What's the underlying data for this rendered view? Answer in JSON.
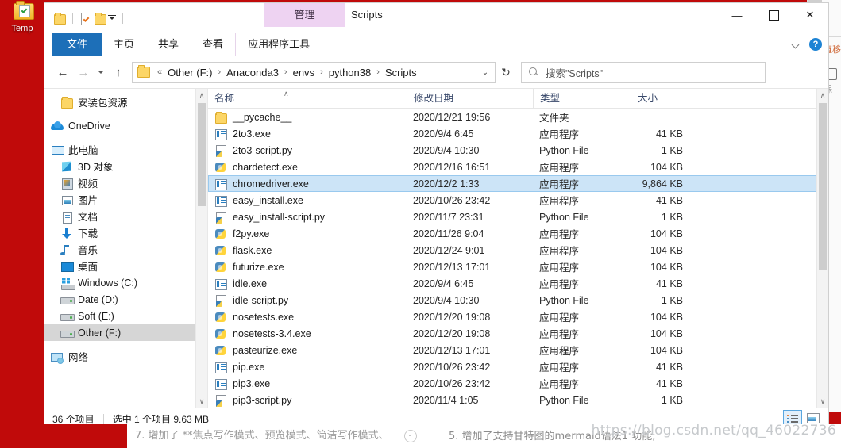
{
  "desktop": {
    "icon_label": "Temp",
    "icon_name": "folder-check-icon",
    "background_color": "#c00a0a"
  },
  "window": {
    "title": "Scripts",
    "contextual_tab_group": "管理",
    "controls": {
      "minimize": "—",
      "maximize": "☐",
      "close": "✕"
    },
    "help_label": "?"
  },
  "quick_access_toolbar": {
    "items": [
      {
        "name": "new-folder-icon",
        "tooltip": "新建文件夹"
      },
      {
        "name": "properties-icon",
        "tooltip": "属性"
      },
      {
        "name": "folder-icon",
        "tooltip": "文件夹"
      },
      {
        "name": "customize-caret-icon",
        "tooltip": "自定义快速访问工具栏"
      }
    ]
  },
  "ribbon": {
    "tabs": [
      {
        "label": "文件",
        "active_style": "file"
      },
      {
        "label": "主页",
        "active_style": "normal"
      },
      {
        "label": "共享",
        "active_style": "normal"
      },
      {
        "label": "查看",
        "active_style": "normal"
      },
      {
        "label": "应用程序工具",
        "active_style": "contextual"
      }
    ],
    "collapse_icon": "chevron-down-icon",
    "help_icon": "help-icon"
  },
  "address_bar": {
    "back": "←",
    "forward": "→",
    "recent_caret": "⌄",
    "up": "↑",
    "overflow": "«",
    "breadcrumbs": [
      "Other (F:)",
      "Anaconda3",
      "envs",
      "python38",
      "Scripts"
    ],
    "separator": "›",
    "dropdown_caret": "⌄",
    "refresh": "↻"
  },
  "search": {
    "placeholder": "搜索\"Scripts\"",
    "icon": "search-icon"
  },
  "sidebar": {
    "items": [
      {
        "label": "安装包资源",
        "icon": "folder-icon",
        "indent": 1,
        "selected": false
      },
      {
        "label": "OneDrive",
        "icon": "cloud-icon",
        "indent": 0,
        "selected": false,
        "gap_before": true
      },
      {
        "label": "此电脑",
        "icon": "pc-icon",
        "indent": 0,
        "selected": false,
        "gap_before": true
      },
      {
        "label": "3D 对象",
        "icon": "3d-objects-icon",
        "indent": 1,
        "selected": false
      },
      {
        "label": "视频",
        "icon": "video-icon",
        "indent": 1,
        "selected": false
      },
      {
        "label": "图片",
        "icon": "pictures-icon",
        "indent": 1,
        "selected": false
      },
      {
        "label": "文档",
        "icon": "documents-icon",
        "indent": 1,
        "selected": false
      },
      {
        "label": "下载",
        "icon": "downloads-icon",
        "indent": 1,
        "selected": false
      },
      {
        "label": "音乐",
        "icon": "music-icon",
        "indent": 1,
        "selected": false
      },
      {
        "label": "桌面",
        "icon": "desktop-icon",
        "indent": 1,
        "selected": false
      },
      {
        "label": "Windows (C:)",
        "icon": "windows-drive-icon",
        "indent": 1,
        "selected": false
      },
      {
        "label": "Date (D:)",
        "icon": "drive-icon",
        "indent": 1,
        "selected": false
      },
      {
        "label": "Soft (E:)",
        "icon": "drive-icon",
        "indent": 1,
        "selected": false
      },
      {
        "label": "Other (F:)",
        "icon": "drive-icon",
        "indent": 1,
        "selected": true
      },
      {
        "label": "网络",
        "icon": "network-icon",
        "indent": 0,
        "selected": false,
        "gap_before": true
      }
    ],
    "scrollbar": {
      "up_arrow": "∧",
      "down_arrow": "∨"
    }
  },
  "file_list": {
    "columns": [
      {
        "label": "名称",
        "key": "name"
      },
      {
        "label": "修改日期",
        "key": "date"
      },
      {
        "label": "类型",
        "key": "type"
      },
      {
        "label": "大小",
        "key": "size"
      }
    ],
    "sort_indicator": "∧",
    "sort_column": "名称",
    "rows": [
      {
        "name": "__pycache__",
        "date": "2020/12/21 19:56",
        "type": "文件夹",
        "size": "",
        "icon": "folder-icon",
        "selected": false
      },
      {
        "name": "2to3.exe",
        "date": "2020/9/4 6:45",
        "type": "应用程序",
        "size": "41 KB",
        "icon": "exe-icon",
        "selected": false
      },
      {
        "name": "2to3-script.py",
        "date": "2020/9/4 10:30",
        "type": "Python File",
        "size": "1 KB",
        "icon": "python-file-icon",
        "selected": false
      },
      {
        "name": "chardetect.exe",
        "date": "2020/12/16 16:51",
        "type": "应用程序",
        "size": "104 KB",
        "icon": "python-exe-icon",
        "selected": false
      },
      {
        "name": "chromedriver.exe",
        "date": "2020/12/2 1:33",
        "type": "应用程序",
        "size": "9,864 KB",
        "icon": "exe-icon",
        "selected": true
      },
      {
        "name": "easy_install.exe",
        "date": "2020/10/26 23:42",
        "type": "应用程序",
        "size": "41 KB",
        "icon": "exe-icon",
        "selected": false
      },
      {
        "name": "easy_install-script.py",
        "date": "2020/11/7 23:31",
        "type": "Python File",
        "size": "1 KB",
        "icon": "python-file-icon",
        "selected": false
      },
      {
        "name": "f2py.exe",
        "date": "2020/11/26 9:04",
        "type": "应用程序",
        "size": "104 KB",
        "icon": "python-exe-icon",
        "selected": false
      },
      {
        "name": "flask.exe",
        "date": "2020/12/24 9:01",
        "type": "应用程序",
        "size": "104 KB",
        "icon": "python-exe-icon",
        "selected": false
      },
      {
        "name": "futurize.exe",
        "date": "2020/12/13 17:01",
        "type": "应用程序",
        "size": "104 KB",
        "icon": "python-exe-icon",
        "selected": false
      },
      {
        "name": "idle.exe",
        "date": "2020/9/4 6:45",
        "type": "应用程序",
        "size": "41 KB",
        "icon": "exe-icon",
        "selected": false
      },
      {
        "name": "idle-script.py",
        "date": "2020/9/4 10:30",
        "type": "Python File",
        "size": "1 KB",
        "icon": "python-file-icon",
        "selected": false
      },
      {
        "name": "nosetests.exe",
        "date": "2020/12/20 19:08",
        "type": "应用程序",
        "size": "104 KB",
        "icon": "python-exe-icon",
        "selected": false
      },
      {
        "name": "nosetests-3.4.exe",
        "date": "2020/12/20 19:08",
        "type": "应用程序",
        "size": "104 KB",
        "icon": "python-exe-icon",
        "selected": false
      },
      {
        "name": "pasteurize.exe",
        "date": "2020/12/13 17:01",
        "type": "应用程序",
        "size": "104 KB",
        "icon": "python-exe-icon",
        "selected": false
      },
      {
        "name": "pip.exe",
        "date": "2020/10/26 23:42",
        "type": "应用程序",
        "size": "41 KB",
        "icon": "exe-icon",
        "selected": false
      },
      {
        "name": "pip3.exe",
        "date": "2020/10/26 23:42",
        "type": "应用程序",
        "size": "41 KB",
        "icon": "exe-icon",
        "selected": false
      },
      {
        "name": "pip3-script.py",
        "date": "2020/11/4 1:05",
        "type": "Python File",
        "size": "1 KB",
        "icon": "python-file-icon",
        "selected": false
      }
    ],
    "scrollbar": {
      "up_arrow": "∧",
      "down_arrow": "∨"
    }
  },
  "status_bar": {
    "item_count": "36 个项目",
    "selection": "选中 1 个项目  9.63 MB",
    "view_buttons": [
      {
        "name": "details-view-button",
        "active": true
      },
      {
        "name": "large-icons-view-button",
        "active": false
      }
    ]
  },
  "background_page": {
    "line_left": "7. 增加了 **焦点写作模式、预览模式、简洁写作模式、",
    "line_right": "5. 增加了支持甘特图的mermaid语法1 功能;",
    "watermark": "https://blog.csdn.net/qq_46022736",
    "side_panel_text_1": "直移",
    "side_panel_text_2": "保"
  }
}
